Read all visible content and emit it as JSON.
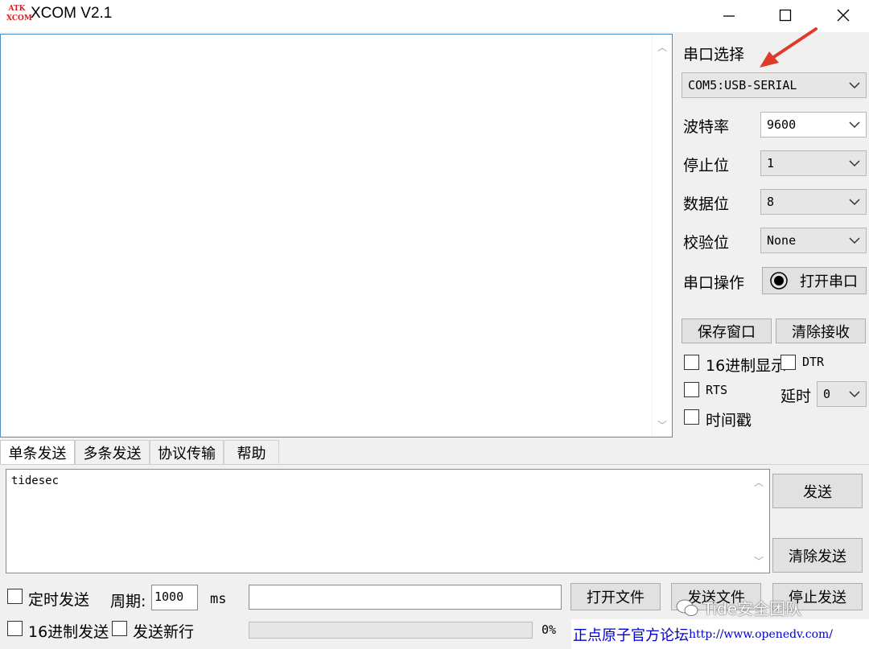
{
  "window": {
    "logo_top": "ATK",
    "logo_bottom": "XCOM",
    "title": "XCOM V2.1"
  },
  "settings": {
    "port_select_label": "串口选择",
    "port_value": "COM5:USB-SERIAL",
    "baud_label": "波特率",
    "baud_value": "9600",
    "stop_label": "停止位",
    "stop_value": "1",
    "data_label": "数据位",
    "data_value": "8",
    "parity_label": "校验位",
    "parity_value": "None",
    "op_label": "串口操作",
    "open_port_button": "打开串口",
    "save_window_button": "保存窗口",
    "clear_recv_button": "清除接收",
    "hex_display_label": "16进制显示",
    "dtr_label": "DTR",
    "rts_label": "RTS",
    "delay_label": "延时",
    "delay_value": "0",
    "timestamp_label": "时间戳"
  },
  "tabs": [
    "单条发送",
    "多条发送",
    "协议传输",
    "帮助"
  ],
  "send": {
    "text": "tidesec",
    "send_button": "发送",
    "clear_send_button": "清除发送",
    "timed_send_label": "定时发送",
    "period_label": "周期:",
    "period_value": "1000",
    "ms_label": "ms",
    "open_file_button": "打开文件",
    "send_file_button": "发送文件",
    "stop_send_button": "停止发送",
    "hex_send_label": "16进制发送",
    "send_newline_label": "发送新行",
    "progress_text": "0%",
    "progress": 0
  },
  "footer": {
    "forum_label": "正点原子官方论坛",
    "url": "http://www.openedv.com/"
  },
  "watermark": "Tide安全团队",
  "colors": {
    "accent_border": "#4a90c8",
    "arrow_red": "#e03a2a",
    "link_blue": "#0000cc"
  }
}
